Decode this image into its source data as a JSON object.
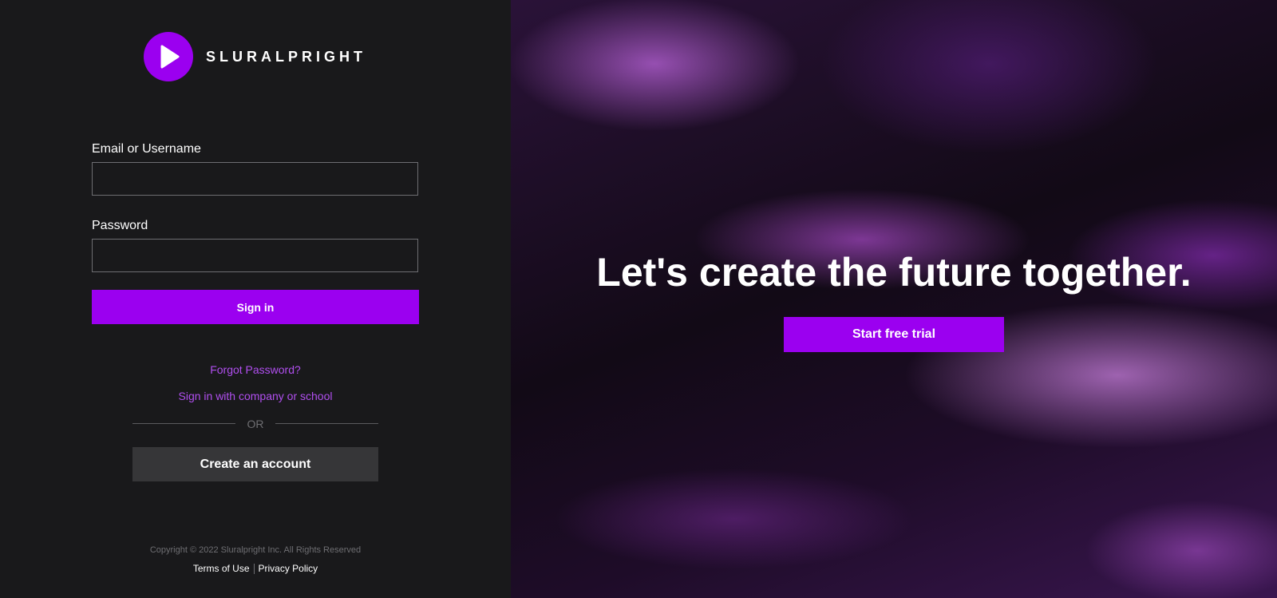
{
  "brand": {
    "name": "SLURALPRIGHT",
    "accent_color": "#9b00f0"
  },
  "login": {
    "email_label": "Email or Username",
    "email_value": "",
    "password_label": "Password",
    "password_value": "",
    "signin_label": "Sign in",
    "forgot_label": "Forgot Password?",
    "company_label": "Sign in with company or school",
    "or_label": "OR",
    "create_label": "Create an account"
  },
  "footer": {
    "copyright": "Copyright © 2022 Sluralpright Inc. All Rights Reserved",
    "terms_label": "Terms of Use",
    "privacy_label": "Privacy Policy"
  },
  "hero": {
    "headline": "Let's create the future together.",
    "cta_label": "Start free trial"
  },
  "icons": {
    "logo": "play-icon"
  }
}
